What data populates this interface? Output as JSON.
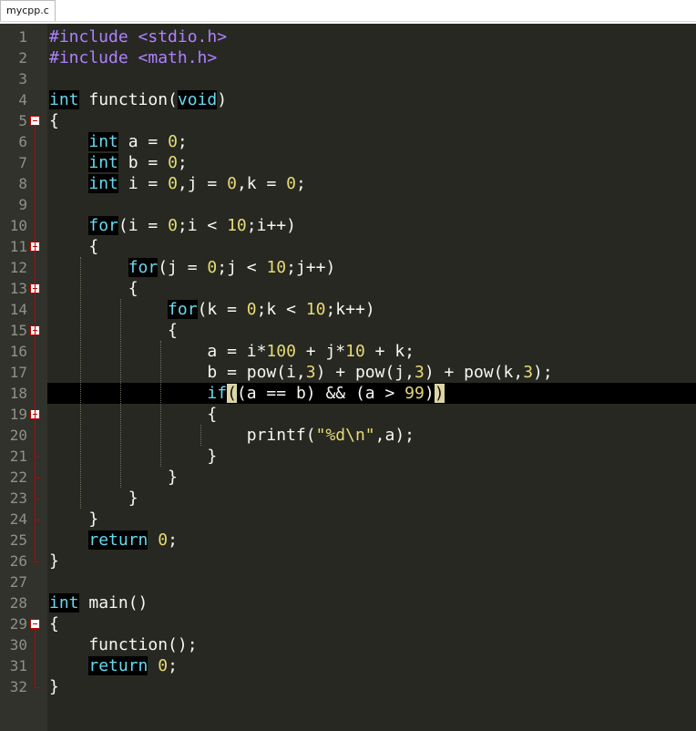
{
  "tab": {
    "title": "mycpp.c"
  },
  "editor": {
    "highlighted_line": 18,
    "folded_lines": [
      5,
      11,
      13,
      15,
      19,
      29
    ],
    "lines": [
      [
        {
          "t": "#include <stdio.h>",
          "c": "pp"
        }
      ],
      [
        {
          "t": "#include <math.h>",
          "c": "pp"
        }
      ],
      [],
      [
        {
          "t": "int",
          "c": "kw"
        },
        {
          "t": " function("
        },
        {
          "t": "void",
          "c": "kw"
        },
        {
          "t": ")"
        }
      ],
      [
        {
          "t": "{"
        }
      ],
      [
        {
          "t": "    "
        },
        {
          "t": "int",
          "c": "kw"
        },
        {
          "t": " a = "
        },
        {
          "t": "0",
          "c": "num"
        },
        {
          "t": ";"
        }
      ],
      [
        {
          "t": "    "
        },
        {
          "t": "int",
          "c": "kw"
        },
        {
          "t": " b = "
        },
        {
          "t": "0",
          "c": "num"
        },
        {
          "t": ";"
        }
      ],
      [
        {
          "t": "    "
        },
        {
          "t": "int",
          "c": "kw"
        },
        {
          "t": " i = "
        },
        {
          "t": "0",
          "c": "num"
        },
        {
          "t": ",j = "
        },
        {
          "t": "0",
          "c": "num"
        },
        {
          "t": ",k = "
        },
        {
          "t": "0",
          "c": "num"
        },
        {
          "t": ";"
        }
      ],
      [],
      [
        {
          "t": "    "
        },
        {
          "t": "for",
          "c": "kw"
        },
        {
          "t": "(i = "
        },
        {
          "t": "0",
          "c": "num"
        },
        {
          "t": ";i < "
        },
        {
          "t": "10",
          "c": "num"
        },
        {
          "t": ";i++)"
        }
      ],
      [
        {
          "t": "    {"
        }
      ],
      [
        {
          "t": "        "
        },
        {
          "t": "for",
          "c": "kw"
        },
        {
          "t": "(j = "
        },
        {
          "t": "0",
          "c": "num"
        },
        {
          "t": ";j < "
        },
        {
          "t": "10",
          "c": "num"
        },
        {
          "t": ";j++)"
        }
      ],
      [
        {
          "t": "        {"
        }
      ],
      [
        {
          "t": "            "
        },
        {
          "t": "for",
          "c": "kw"
        },
        {
          "t": "(k = "
        },
        {
          "t": "0",
          "c": "num"
        },
        {
          "t": ";k < "
        },
        {
          "t": "10",
          "c": "num"
        },
        {
          "t": ";k++)"
        }
      ],
      [
        {
          "t": "            {"
        }
      ],
      [
        {
          "t": "                a = i*"
        },
        {
          "t": "100",
          "c": "num"
        },
        {
          "t": " + j*"
        },
        {
          "t": "10",
          "c": "num"
        },
        {
          "t": " + k;"
        }
      ],
      [
        {
          "t": "                b = pow(i,"
        },
        {
          "t": "3",
          "c": "num"
        },
        {
          "t": ") + pow(j,"
        },
        {
          "t": "3",
          "c": "num"
        },
        {
          "t": ") + pow(k,"
        },
        {
          "t": "3",
          "c": "num"
        },
        {
          "t": ");"
        }
      ],
      [
        {
          "t": "                "
        },
        {
          "t": "if",
          "c": "kw"
        },
        {
          "t": "(",
          "c": "bm"
        },
        {
          "t": "(a == b) && (a > "
        },
        {
          "t": "99",
          "c": "num"
        },
        {
          "t": ")"
        },
        {
          "t": ")",
          "c": "bm"
        }
      ],
      [
        {
          "t": "                {"
        }
      ],
      [
        {
          "t": "                    printf("
        },
        {
          "t": "\"%d\\n\"",
          "c": "str"
        },
        {
          "t": ",a);"
        }
      ],
      [
        {
          "t": "                }"
        }
      ],
      [
        {
          "t": "            }"
        }
      ],
      [
        {
          "t": "        }"
        }
      ],
      [
        {
          "t": "    }"
        }
      ],
      [
        {
          "t": "    "
        },
        {
          "t": "return",
          "c": "kw"
        },
        {
          "t": " "
        },
        {
          "t": "0",
          "c": "num"
        },
        {
          "t": ";"
        }
      ],
      [
        {
          "t": "}"
        }
      ],
      [],
      [
        {
          "t": "int",
          "c": "kw"
        },
        {
          "t": " main()"
        }
      ],
      [
        {
          "t": "{"
        }
      ],
      [
        {
          "t": "    function();"
        }
      ],
      [
        {
          "t": "    "
        },
        {
          "t": "return",
          "c": "kw"
        },
        {
          "t": " "
        },
        {
          "t": "0",
          "c": "num"
        },
        {
          "t": ";"
        }
      ],
      [
        {
          "t": "}"
        }
      ]
    ]
  },
  "colors": {
    "background": "#272822",
    "gutter": "#31322c",
    "keyword": "#66d9ef",
    "number": "#e6db74",
    "preprocessor": "#ae81ff",
    "fold_marker": "#c00000"
  }
}
